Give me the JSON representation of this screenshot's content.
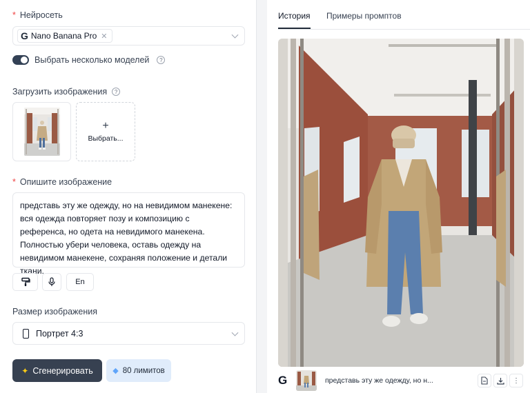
{
  "left": {
    "neural_label": "Нейросеть",
    "model_chip": "Nano Banana Pro",
    "multi_models_label": "Выбрать несколько моделей",
    "upload_label": "Загрузить изображения",
    "upload_button": "Выбрать...",
    "describe_label": "Опишите изображение",
    "prompt_text": "представь эту же одежду, но на невидимом манекене: вся одежда повторяет позу и композицию с референса, но одета на невидимого манекена. Полностью убери человека, оставь одежду на невидимом манекене, сохраняя положение и детали ткани.",
    "lang_button": "En",
    "size_label": "Размер изображения",
    "size_value": "Портрет 4:3",
    "generate_button": "Сгенерировать",
    "limits_badge": "80 лимитов"
  },
  "right": {
    "tabs": [
      {
        "label": "История",
        "active": true
      },
      {
        "label": "Примеры промптов",
        "active": false
      }
    ],
    "history_item": {
      "prompt_preview": "представь эту же одежду, но н..."
    }
  },
  "colors": {
    "accent_dark": "#374151",
    "required": "#ef4444",
    "limits_bg": "#e0ecfb",
    "spark": "#facc15"
  },
  "icons": [
    "google-g-icon",
    "close-icon",
    "chevron-down-icon",
    "help-icon",
    "plus-icon",
    "brush-icon",
    "microphone-icon",
    "phone-portrait-icon",
    "sparkle-icon",
    "diamond-icon",
    "file-icon",
    "download-icon",
    "more-vertical-icon"
  ]
}
